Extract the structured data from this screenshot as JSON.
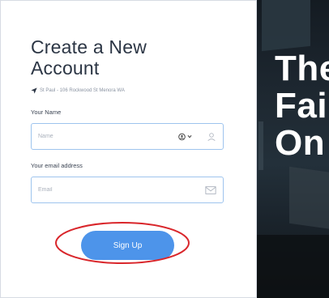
{
  "form": {
    "title_line1": "Create a New",
    "title_line2": "Account",
    "location": "St Paul - 106 Rockwood St Menora WA",
    "name_label": "Your Name",
    "name_placeholder": "Name",
    "email_label": "Your email address",
    "email_placeholder": "Email",
    "signup_label": "Sign Up"
  },
  "hero": {
    "line1": "The",
    "line2": "Fai",
    "line3": "On"
  },
  "colors": {
    "button": "#4d94ea",
    "highlight_circle": "#d9262b",
    "field_border": "#9ec4ee"
  },
  "icons": [
    "location-arrow-icon",
    "user-icon",
    "grammarly-icon",
    "chevron-down-icon",
    "envelope-icon"
  ]
}
